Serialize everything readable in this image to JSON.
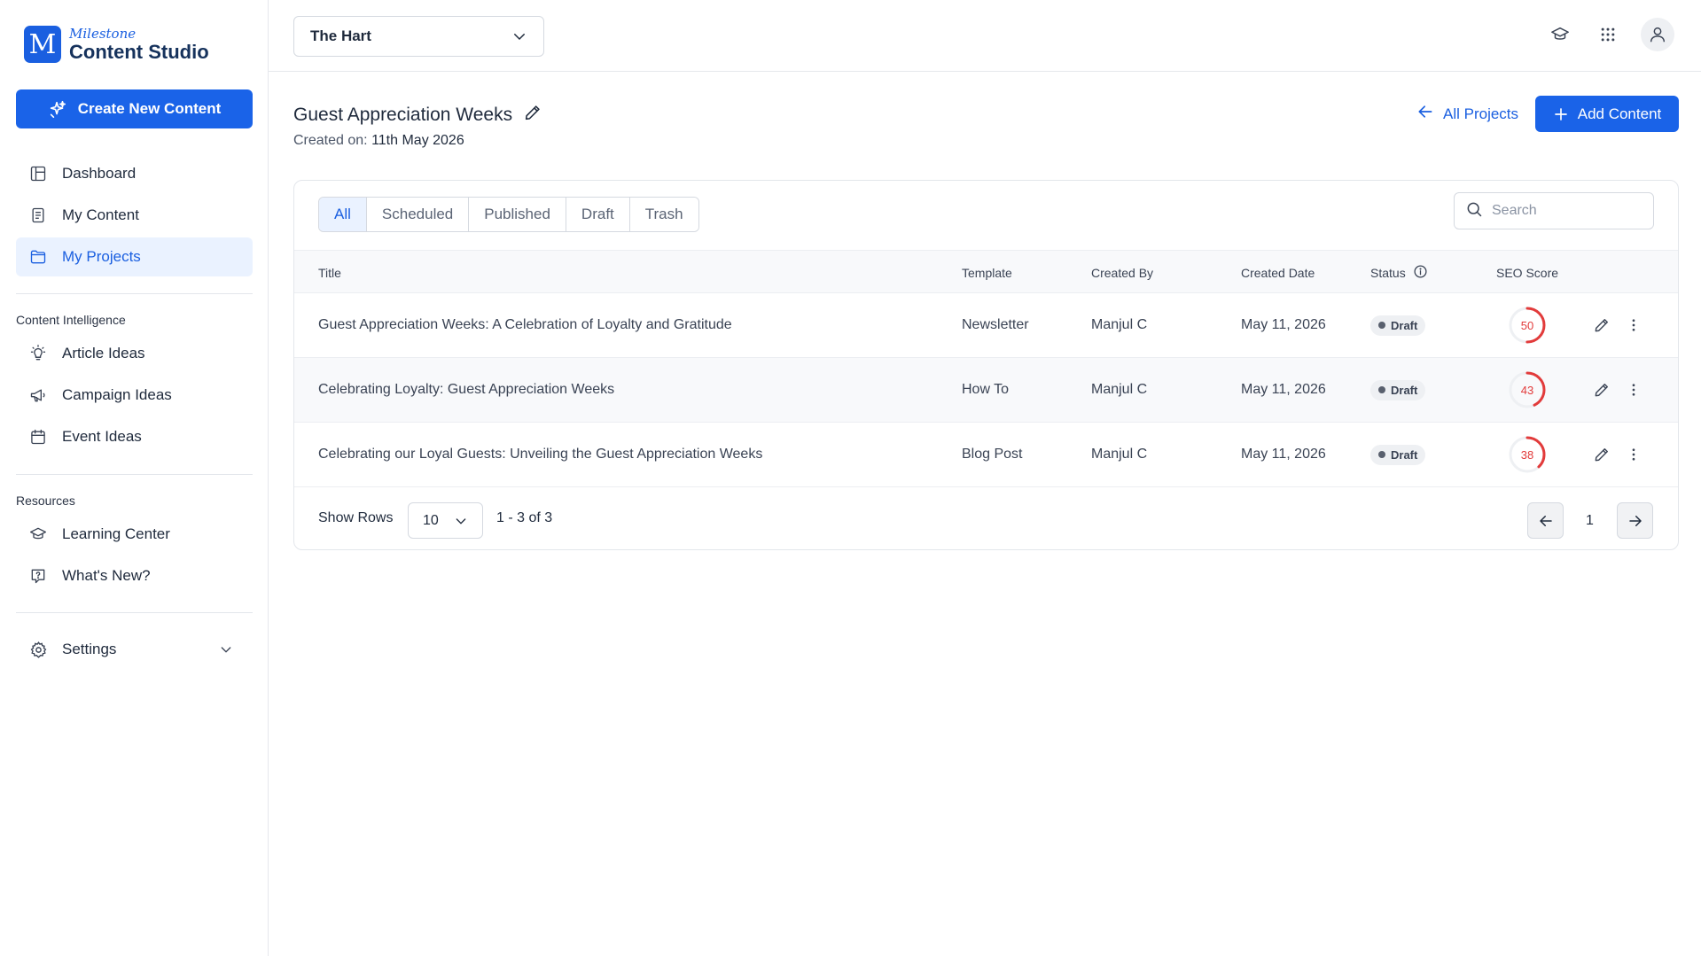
{
  "brand": {
    "mark": "M",
    "sub": "Milestone",
    "name": "Content Studio"
  },
  "sidebar": {
    "create_label": "Create New Content",
    "main_items": [
      {
        "label": "Dashboard",
        "icon": "dashboard-icon"
      },
      {
        "label": "My Content",
        "icon": "document-icon"
      },
      {
        "label": "My Projects",
        "icon": "folder-icon",
        "active": true
      }
    ],
    "intelligence_title": "Content Intelligence",
    "intelligence_items": [
      {
        "label": "Article Ideas",
        "icon": "lightbulb-icon"
      },
      {
        "label": "Campaign Ideas",
        "icon": "megaphone-icon"
      },
      {
        "label": "Event Ideas",
        "icon": "calendar-icon"
      }
    ],
    "resources_title": "Resources",
    "resources_items": [
      {
        "label": "Learning Center",
        "icon": "graduation-cap-icon"
      },
      {
        "label": "What's New?",
        "icon": "question-bubble-icon"
      }
    ],
    "settings_label": "Settings"
  },
  "topbar": {
    "project_selected": "The Hart"
  },
  "page": {
    "title": "Guest Appreciation Weeks",
    "created_label": "Created on:",
    "created_value": "11th May 2026",
    "all_projects_label": "All Projects",
    "add_content_label": "Add Content"
  },
  "tabs": [
    "All",
    "Scheduled",
    "Published",
    "Draft",
    "Trash"
  ],
  "active_tab": "All",
  "search": {
    "placeholder": "Search"
  },
  "table": {
    "headers": {
      "title": "Title",
      "template": "Template",
      "created_by": "Created By",
      "created_date": "Created Date",
      "status": "Status",
      "seo": "SEO Score"
    },
    "rows": [
      {
        "title": "Guest Appreciation Weeks: A Celebration of Loyalty and Gratitude",
        "template": "Newsletter",
        "created_by": "Manjul C",
        "created_date": "May 11, 2026",
        "status": "Draft",
        "seo": "50",
        "seo_fraction": 0.5
      },
      {
        "title": "Celebrating Loyalty: Guest Appreciation Weeks",
        "template": "How To",
        "created_by": "Manjul C",
        "created_date": "May 11, 2026",
        "status": "Draft",
        "seo": "43",
        "seo_fraction": 0.43
      },
      {
        "title": "Celebrating our Loyal Guests: Unveiling the Guest Appreciation Weeks",
        "template": "Blog Post",
        "created_by": "Manjul C",
        "created_date": "May 11, 2026",
        "status": "Draft",
        "seo": "38",
        "seo_fraction": 0.38
      }
    ]
  },
  "pagination": {
    "show_rows_label": "Show Rows",
    "rows_per_page": "10",
    "range": "1 - 3 of 3",
    "current_page": "1"
  },
  "colors": {
    "accent": "#1a63e8",
    "active_bg": "#eaf2ff",
    "seo_low": "#e23b3b"
  }
}
